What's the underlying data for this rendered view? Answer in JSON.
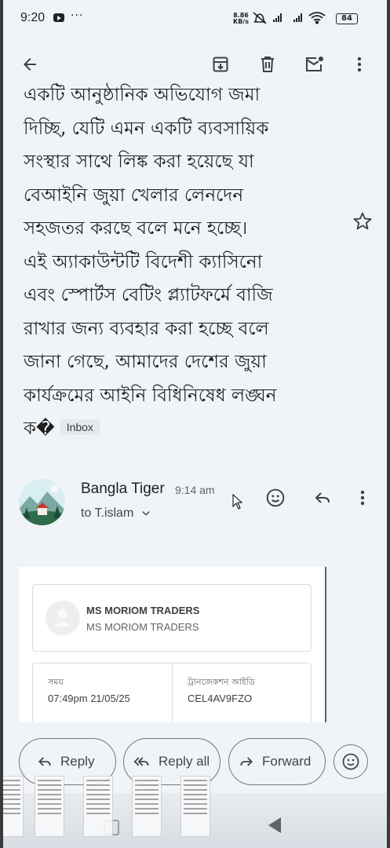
{
  "status_bar": {
    "time": "9:20",
    "overflow": "···",
    "net_speed_value": "8.86",
    "net_speed_unit": "KB/s",
    "battery": "84"
  },
  "toolbar": {
    "icons": [
      "back-arrow-icon",
      "archive-icon",
      "delete-icon",
      "mark-unread-icon",
      "more-vert-icon"
    ]
  },
  "email_body": {
    "lines": [
      "একটি আনুষ্ঠানিক অভিযোগ জমা",
      "দিচ্ছি, যেটি এমন একটি ব্যবসায়িক",
      "সংস্থার সাথে লিঙ্ক করা হয়েছে যা",
      "বেআইনি জুয়া খেলার লেনদেন",
      "সহজতর করছে বলে মনে হচ্ছে।",
      "এই অ্যাকাউন্টটি বিদেশী ক্যাসিনো",
      "এবং স্পোর্টস বেটিং প্ল্যাটফর্মে বাজি",
      "রাখার জন্য ব্যবহার করা হচ্ছে বলে",
      "জানা গেছে, আমাদের দেশের জুয়া",
      "কার্যক্রমের আইনি বিধিনিষেধ লঙ্ঘন"
    ],
    "last_line": "ক�",
    "label_chip": "Inbox"
  },
  "sender": {
    "name": "Bangla Tiger",
    "time": "9:14 am",
    "to": "to T.islam"
  },
  "card": {
    "merchant_name": "MS MORIOM TRADERS",
    "merchant_sub": "MS MORIOM TRADERS",
    "time_label": "সময়",
    "time_value": "07:49pm 21/05/25",
    "txn_label": "ট্রানজেকশন আইডি",
    "txn_value": "CEL4AV9FZO"
  },
  "actions": {
    "reply": "Reply",
    "reply_all": "Reply all",
    "forward": "Forward"
  },
  "colors": {
    "background": "#f0f4f9",
    "text": "#1f1f1f",
    "icon": "#3c4043"
  }
}
